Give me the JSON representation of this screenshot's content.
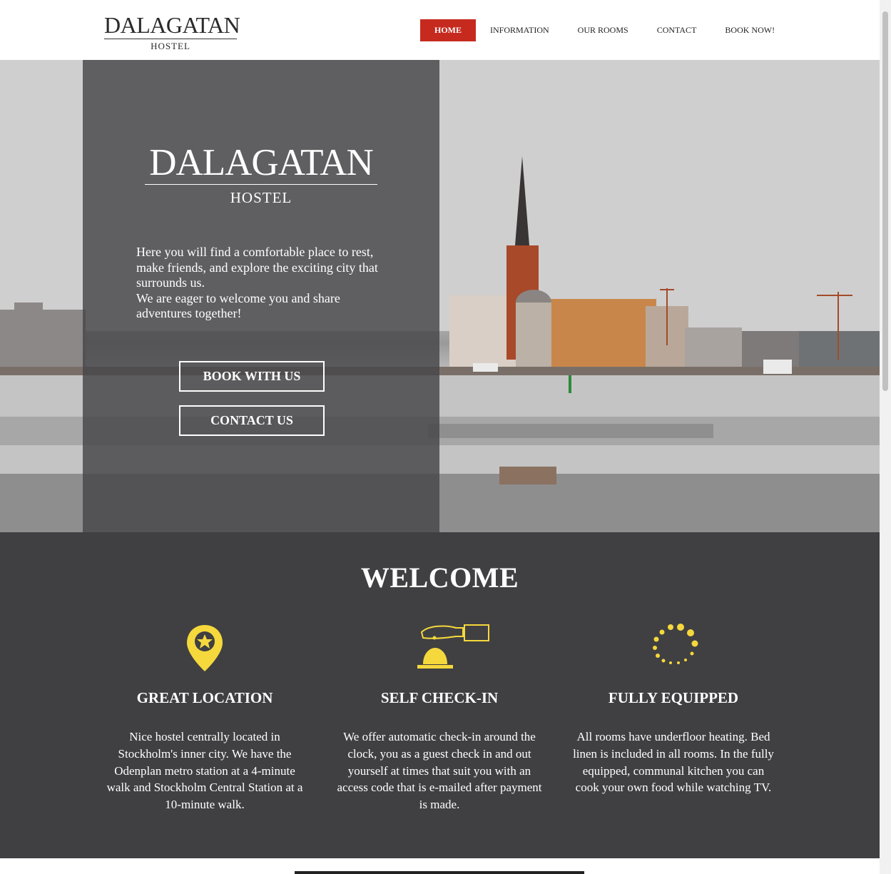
{
  "header": {
    "logo_name": "DALAGATAN",
    "logo_sub": "HOSTEL",
    "nav": [
      "HOME",
      "INFORMATION",
      "OUR ROOMS",
      "CONTACT",
      "BOOK NOW!"
    ]
  },
  "hero": {
    "logo_name": "DALAGATAN",
    "logo_sub": "HOSTEL",
    "paragraph1": "Here you will find a comfortable place to rest, make friends, and explore the exciting city that surrounds us.",
    "paragraph2": "We are eager to welcome you and share adventures together!",
    "book_button": "BOOK WITH US",
    "contact_button": "CONTACT US"
  },
  "welcome": {
    "title": "WELCOME",
    "features": [
      {
        "title": "GREAT LOCATION",
        "icon": "location-star-icon",
        "text": "Nice hostel centrally located in Stockholm's inner city. We have the Odenplan metro station at a 4-minute walk and Stockholm Central Station at a 10-minute walk."
      },
      {
        "title": "SELF CHECK-IN",
        "icon": "reception-bell-icon",
        "text": "We offer automatic check-in around the clock, you as a guest check in and out yourself at times that suit you with an access code that is e-mailed after payment is made."
      },
      {
        "title": "FULLY EQUIPPED",
        "icon": "loading-dots-icon",
        "text": "All rooms have underfloor heating. Bed linen is included in all rooms. In the fully equipped, communal kitchen you can cook your own food while watching TV."
      }
    ]
  },
  "colors": {
    "accent": "#c62a1f",
    "icon_yellow": "#f5d83c",
    "dark_bg": "#404042"
  }
}
